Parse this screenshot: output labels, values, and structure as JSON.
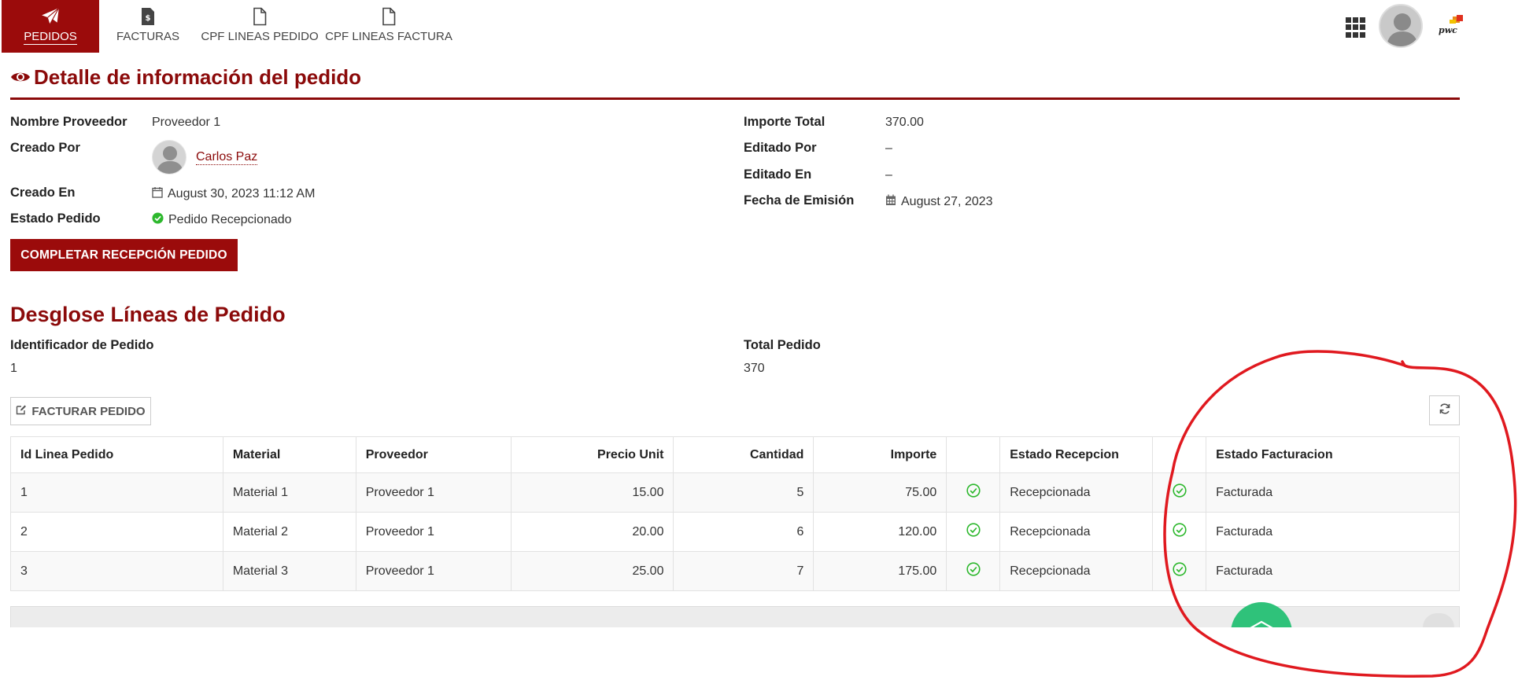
{
  "nav": {
    "items": [
      {
        "label": "PEDIDOS",
        "icon": "paper-plane-icon",
        "active": true
      },
      {
        "label": "FACTURAS",
        "icon": "invoice-dollar-icon",
        "active": false
      },
      {
        "label": "CPF LINEAS PEDIDO",
        "icon": "file-icon",
        "active": false
      },
      {
        "label": "CPF LINEAS FACTURA",
        "icon": "file-icon",
        "active": false
      }
    ],
    "logo_text": "pwc",
    "active_color": "#9b0b0b"
  },
  "detail": {
    "title": "Detalle de información del pedido",
    "left": {
      "proveedor_label": "Nombre Proveedor",
      "proveedor_value": "Proveedor 1",
      "creado_por_label": "Creado Por",
      "creado_por_value": "Carlos Paz",
      "creado_en_label": "Creado En",
      "creado_en_value": "August 30, 2023 11:12 AM",
      "estado_label": "Estado Pedido",
      "estado_value": "Pedido Recepcionado"
    },
    "right": {
      "importe_label": "Importe Total",
      "importe_value": "370.00",
      "editado_por_label": "Editado Por",
      "editado_por_value": "–",
      "editado_en_label": "Editado En",
      "editado_en_value": "–",
      "fecha_label": "Fecha de Emisión",
      "fecha_value": "August 27, 2023"
    },
    "complete_button": "COMPLETAR RECEPCIÓN PEDIDO"
  },
  "breakdown": {
    "title": "Desglose Líneas de Pedido",
    "id_label": "Identificador de Pedido",
    "id_value": "1",
    "total_label": "Total Pedido",
    "total_value": "370",
    "invoice_button": "FACTURAR PEDIDO"
  },
  "table": {
    "headers": {
      "id": "Id Linea Pedido",
      "material": "Material",
      "proveedor": "Proveedor",
      "precio": "Precio Unit",
      "cantidad": "Cantidad",
      "importe": "Importe",
      "recepcion": "Estado Recepcion",
      "facturacion": "Estado Facturacion"
    },
    "rows": [
      {
        "id": "1",
        "material": "Material 1",
        "proveedor": "Proveedor 1",
        "precio": "15.00",
        "cantidad": "5",
        "importe": "75.00",
        "recepcion": "Recepcionada",
        "facturacion": "Facturada"
      },
      {
        "id": "2",
        "material": "Material 2",
        "proveedor": "Proveedor 1",
        "precio": "20.00",
        "cantidad": "6",
        "importe": "120.00",
        "recepcion": "Recepcionada",
        "facturacion": "Facturada"
      },
      {
        "id": "3",
        "material": "Material 3",
        "proveedor": "Proveedor 1",
        "precio": "25.00",
        "cantidad": "7",
        "importe": "175.00",
        "recepcion": "Recepcionada",
        "facturacion": "Facturada"
      }
    ]
  },
  "colors": {
    "brand": "#8b0a0a",
    "success": "#2db82d",
    "fab": "#2fc27a",
    "annotation": "#e0191f"
  }
}
